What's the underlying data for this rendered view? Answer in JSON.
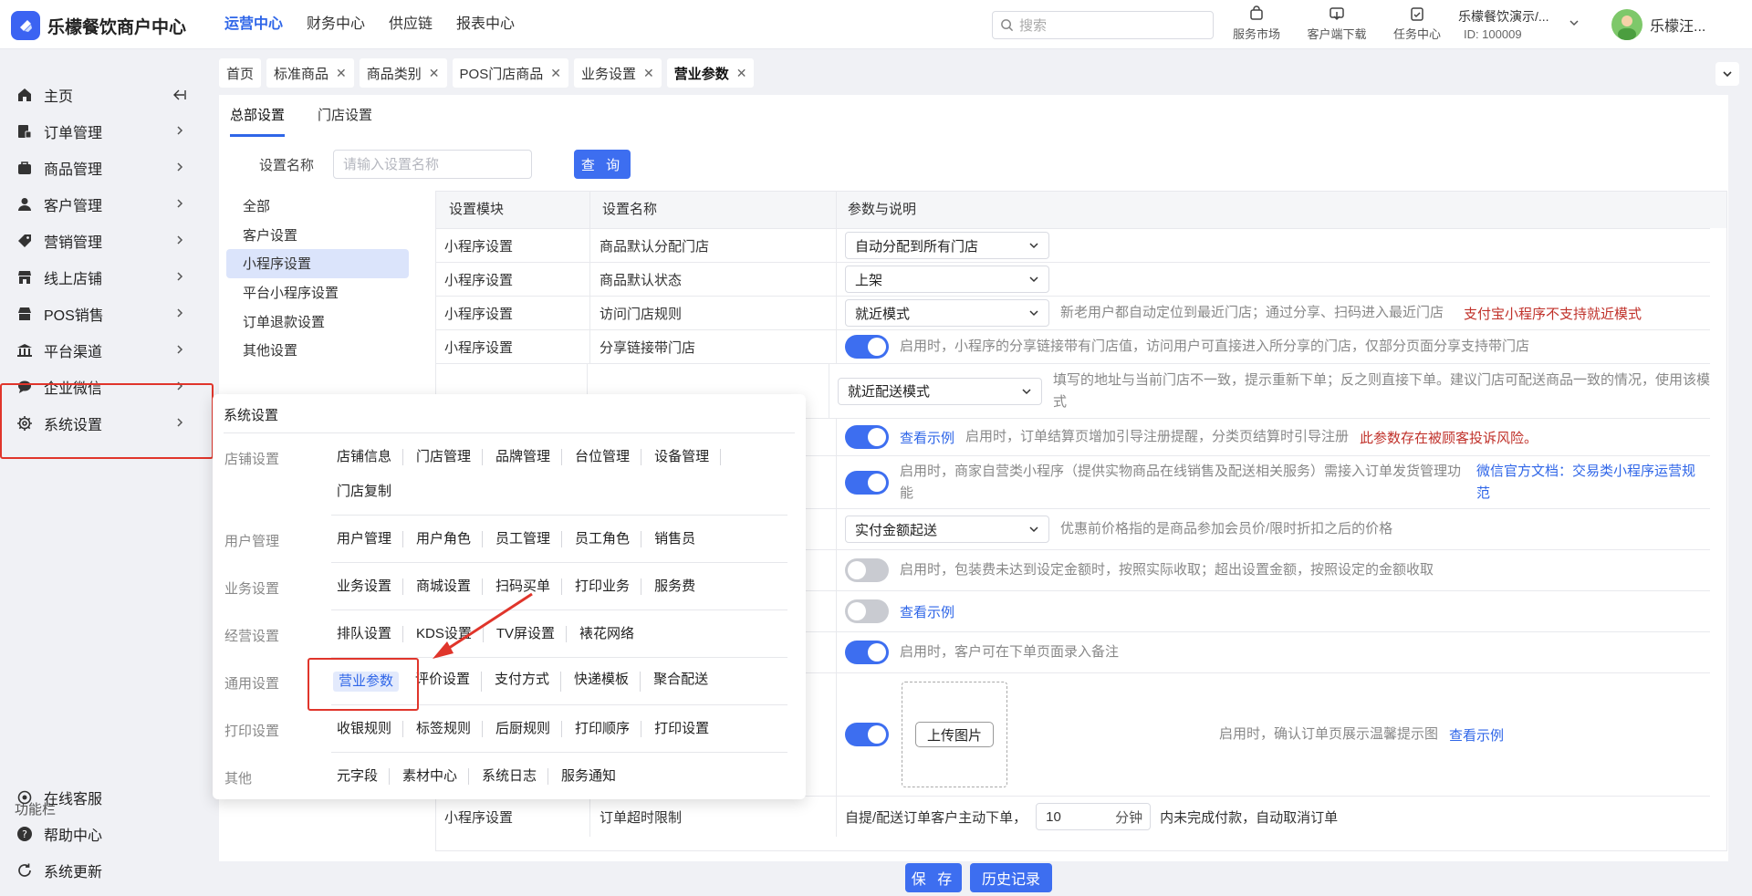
{
  "app": {
    "title": "乐檬餐饮商户中心"
  },
  "topnav": [
    "运营中心",
    "财务中心",
    "供应链",
    "报表中心"
  ],
  "search": {
    "placeholder": "搜索"
  },
  "tools": [
    "服务市场",
    "客户端下载",
    "任务中心"
  ],
  "tenant": {
    "name": "乐檬餐饮演示/...",
    "id": "ID: 100009"
  },
  "user": {
    "name": "乐檬汪..."
  },
  "sidebar": {
    "items": [
      "主页",
      "订单管理",
      "商品管理",
      "客户管理",
      "营销管理",
      "线上店铺",
      "POS销售",
      "平台渠道",
      "企业微信",
      "系统设置"
    ],
    "func_title": "功能栏",
    "func_items": [
      "在线客服",
      "帮助中心",
      "系统更新"
    ]
  },
  "tabs": [
    "首页",
    "标准商品",
    "商品类别",
    "POS门店商品",
    "业务设置",
    "营业参数"
  ],
  "subtabs": [
    "总部设置",
    "门店设置"
  ],
  "filter": {
    "label": "设置名称",
    "placeholder": "请输入设置名称",
    "button": "查 询"
  },
  "categories": [
    "全部",
    "客户设置",
    "小程序设置",
    "平台小程序设置",
    "订单退款设置",
    "其他设置"
  ],
  "table": {
    "headers": [
      "设置模块",
      "设置名称",
      "参数与说明"
    ],
    "rows": [
      {
        "module": "小程序设置",
        "name": "商品默认分配门店",
        "select": "自动分配到所有门店"
      },
      {
        "module": "小程序设置",
        "name": "商品默认状态",
        "select": "上架"
      },
      {
        "module": "小程序设置",
        "name": "访问门店规则",
        "select": "就近模式",
        "desc": "新老用户都自动定位到最近门店；通过分享、扫码进入最近门店",
        "warn": "支付宝小程序不支持就近模式"
      },
      {
        "module": "小程序设置",
        "name": "分享链接带门店",
        "desc": "启用时，小程序的分享链接带有门店值，访问用户可直接进入所分享的门店，仅部分页面分享支持带门店"
      },
      {
        "select": "就近配送模式",
        "desc": "填写的地址与当前门店不一致，提示重新下单；反之则直接下单。建议门店可配送商品一致的情况，使用该模式"
      },
      {
        "link": "查看示例",
        "desc": "启用时，订单结算页增加引导注册提醒，分类页结算时引导注册",
        "warn": "此参数存在被顾客投诉风险。"
      },
      {
        "desc": "启用时，商家自营类小程序（提供实物商品在线销售及配送相关服务）需接入订单发货管理功能",
        "link": "微信官方文档：交易类小程序运营规范"
      },
      {
        "select": "实付金额起送",
        "desc": "优惠前价格指的是商品参加会员价/限时折扣之后的价格"
      },
      {
        "desc": "启用时，包装费未达到设定金额时，按照实际收取；超出设置金额，按照设定的金额收取"
      },
      {
        "link": "查看示例"
      },
      {
        "desc": "启用时，客户可在下单页面录入备注"
      },
      {
        "upload": "上传图片",
        "desc": "启用时，确认订单页展示温馨提示图",
        "link": "查看示例"
      },
      {
        "module": "小程序设置",
        "name": "订单超时限制",
        "pre": "自提/配送订单客户主动下单，",
        "value": "10",
        "unit": "分钟",
        "desc": "内未完成付款，自动取消订单"
      }
    ]
  },
  "toggles": [
    true,
    true,
    true,
    false,
    false,
    true,
    true
  ],
  "footer": {
    "save": "保 存",
    "history": "历史记录"
  },
  "mega": {
    "title": "系统设置",
    "sections": [
      {
        "name": "店铺设置",
        "links": [
          "店铺信息",
          "门店管理",
          "品牌管理",
          "台位管理",
          "设备管理",
          "门店复制"
        ]
      },
      {
        "name": "用户管理",
        "links": [
          "用户管理",
          "用户角色",
          "员工管理",
          "员工角色",
          "销售员"
        ]
      },
      {
        "name": "业务设置",
        "links": [
          "业务设置",
          "商城设置",
          "扫码买单",
          "打印业务",
          "服务费"
        ]
      },
      {
        "name": "经营设置",
        "links": [
          "排队设置",
          "KDS设置",
          "TV屏设置",
          "裱花网络"
        ]
      },
      {
        "name": "通用设置",
        "links": [
          "营业参数",
          "评价设置",
          "支付方式",
          "快递模板",
          "聚合配送"
        ]
      },
      {
        "name": "打印设置",
        "links": [
          "收银规则",
          "标签规则",
          "后厨规则",
          "打印顺序",
          "打印设置"
        ]
      },
      {
        "name": "其他",
        "links": [
          "元字段",
          "素材中心",
          "系统日志",
          "服务通知"
        ]
      }
    ]
  },
  "colors": {
    "accent": "#3d6ef0",
    "warn": "#c0312a",
    "highlight": "#e0352b"
  }
}
